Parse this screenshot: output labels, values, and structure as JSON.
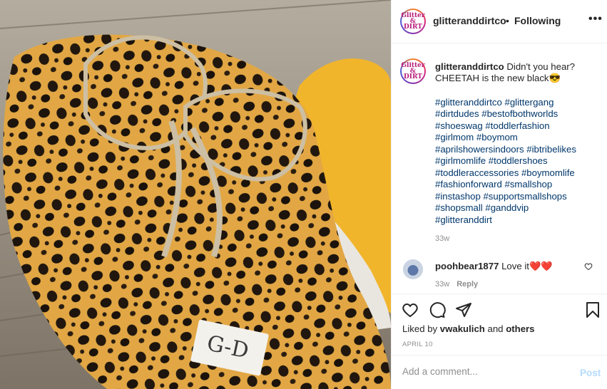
{
  "post": {
    "username": "glitteranddirtco",
    "follow_status": "Following",
    "more_label": "•••",
    "avatar_text": "Glitter & DIRT",
    "caption_text": " Didn't you hear? CHEETAH is the new black😎",
    "hashtags": [
      "#glitteranddirtco #glittergang",
      "#dirtdudes #bestofbothworlds",
      "#shoeswag #toddlerfashion",
      "#girlmom #boymom",
      "#aprilshowersindoors #ibtribelikes",
      "#girlmomlife #toddlershoes",
      "#toddleraccessories #boymomlife",
      "#fashionforward #smallshop",
      "#instashop #supportsmallshops",
      "#shopsmall #ganddvip",
      "#glitteranddirt"
    ],
    "caption_time": "33w"
  },
  "comment": {
    "username": "poohbear1877",
    "text": " Love it❤️❤️",
    "time": "33w",
    "reply_label": "Reply"
  },
  "likes": {
    "prefix": "Liked by ",
    "user": "vwakulich",
    "joiner": " and ",
    "others": "others"
  },
  "date": "APRIL 10",
  "add_comment": {
    "placeholder": "Add a comment...",
    "post_label": "Post"
  },
  "photo": {
    "label_text": "G-D"
  },
  "icons": {
    "like": "heart-icon",
    "comment": "comment-icon",
    "share": "share-icon",
    "save": "bookmark-icon",
    "more": "more-icon"
  },
  "colors": {
    "link": "#00376b",
    "muted": "#8e8e8e",
    "post_button": "#b3dbff",
    "heart": "#ed4956"
  }
}
